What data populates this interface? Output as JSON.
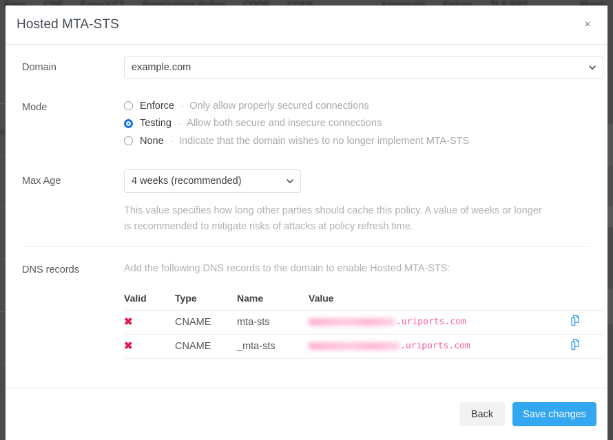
{
  "backdrop": {
    "nav_items": [
      "Error",
      "CSP",
      "Expect-CT",
      "Permissions-Policy",
      "COOP",
      "COEP",
      "Aggregate",
      "Failure",
      "TLS-RPT",
      "Monitor"
    ],
    "stray_letter": "a"
  },
  "modal": {
    "title": "Hosted MTA-STS",
    "close_label": "×",
    "domain": {
      "label": "Domain",
      "value": "example.com"
    },
    "mode": {
      "label": "Mode",
      "separator": "·",
      "options": [
        {
          "name": "Enforce",
          "description": "Only allow properly secured connections",
          "selected": false
        },
        {
          "name": "Testing",
          "description": "Allow both secure and insecure connections",
          "selected": true
        },
        {
          "name": "None",
          "description": "Indicate that the domain wishes to no longer implement MTA-STS",
          "selected": false
        }
      ]
    },
    "max_age": {
      "label": "Max Age",
      "value": "4 weeks (recommended)",
      "help": "This value specifies how long other parties should cache this policy. A value of weeks or longer is recommended to mitigate risks of attacks at policy refresh time."
    },
    "dns": {
      "label": "DNS records",
      "intro": "Add the following DNS records to the domain to enable Hosted MTA-STS:",
      "columns": [
        "Valid",
        "Type",
        "Name",
        "Value"
      ],
      "rows": [
        {
          "valid": false,
          "valid_mark": "✖",
          "type": "CNAME",
          "name": "mta-sts",
          "value_redacted": true,
          "value_suffix": ".uriports.com",
          "copy_icon": "copy-icon"
        },
        {
          "valid": false,
          "valid_mark": "✖",
          "type": "CNAME",
          "name": "_mta-sts",
          "value_redacted": true,
          "value_suffix": ".uriports.com",
          "copy_icon": "copy-icon"
        }
      ]
    },
    "footer": {
      "back_label": "Back",
      "save_label": "Save changes"
    }
  },
  "colors": {
    "accent_blue": "#33a7ef",
    "radio_blue": "#1a73e8",
    "invalid_red": "#e8174a",
    "value_pink": "#ff5aa0",
    "copy_blue": "#3ba3ef"
  }
}
